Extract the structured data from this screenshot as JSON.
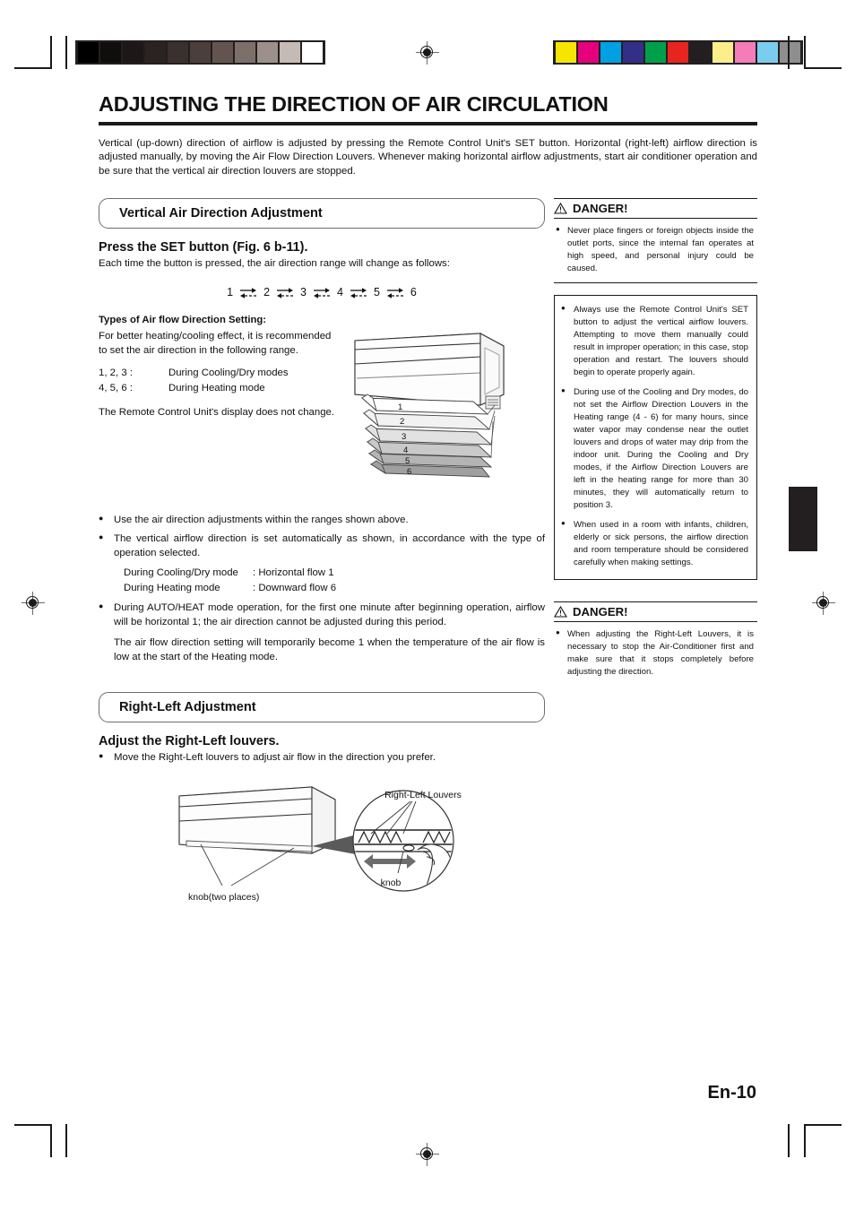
{
  "page": {
    "title": "ADJUSTING THE DIRECTION OF AIR CIRCULATION",
    "number": "En-10",
    "intro": "Vertical (up-down) direction of airflow is adjusted by pressing the Remote Control Unit's SET button. Horizontal (right-left) airflow direction is adjusted manually, by moving the Air Flow Direction Louvers. Whenever making horizontal airflow adjustments, start air conditioner operation and be sure that the vertical air direction louvers are stopped."
  },
  "vertical_section": {
    "banner": "Vertical Air Direction Adjustment",
    "heading": "Press the SET button (Fig. 6 b-11).",
    "lead": "Each time the button is pressed, the air direction range will change as follows:",
    "sequence": [
      "1",
      "2",
      "3",
      "4",
      "5",
      "6"
    ],
    "types_label": "Types of Air flow Direction Setting:",
    "types_lead": "For better heating/cooling effect, it is recommended to set the air direction in the following range.",
    "modes": [
      {
        "key": "1, 2, 3 :",
        "value": "During Cooling/Dry modes"
      },
      {
        "key": "4, 5, 6 :",
        "value": "During Heating mode"
      }
    ],
    "display_note": "The Remote Control Unit's display does not change.",
    "figure_labels": [
      "1",
      "2",
      "3",
      "4",
      "5",
      "6"
    ],
    "bullets": [
      "Use the air direction adjustments within the ranges shown above.",
      "The vertical airflow direction is set automatically as shown, in accordance with the type of operation selected."
    ],
    "auto_modes": [
      {
        "mode": "During Cooling/Dry mode",
        "flow": ": Horizontal flow 1"
      },
      {
        "mode": "During Heating mode",
        "flow": ": Downward flow 6"
      }
    ],
    "bullet_auto_heat": "During AUTO/HEAT mode operation, for the first one minute after beginning operation, airflow will be horizontal 1; the air direction cannot be adjusted during this period.",
    "temp_note": "The air flow direction setting will temporarily become 1 when the temperature of the air flow is low at the start of the Heating mode."
  },
  "rightleft_section": {
    "banner": "Right-Left Adjustment",
    "heading": "Adjust the Right-Left louvers.",
    "bullet": "Move the Right-Left louvers to adjust air flow in the direction you prefer.",
    "figure": {
      "louvers_label": "Right-Left Louvers",
      "knob_label": "knob",
      "knob_two_places_label": "knob(two places)"
    }
  },
  "danger_boxes": [
    {
      "title": "DANGER!",
      "items": [
        "Never place fingers or foreign objects inside the outlet ports, since the internal fan operates at high speed, and personal injury could be caused."
      ]
    },
    {
      "title": "DANGER!",
      "items": [
        "When adjusting the Right-Left Louvers, it is necessary to stop the Air-Conditioner first and make sure that it stops completely before adjusting the direction."
      ]
    }
  ],
  "caution_box": {
    "items": [
      "Always use the Remote Control Unit's SET button to adjust the vertical airflow louvers. Attempting to move them manually could result in improper operation; in this case, stop operation and restart. The louvers should begin to operate properly again.",
      "During use of the Cooling and Dry modes, do not set the Airflow Direction Louvers in the Heating range (4 - 6) for many hours, since water vapor may condense near the outlet louvers and drops of water may drip from the indoor unit. During the Cooling and Dry modes, if the Airflow Direction Louvers are left in the heating range for more than 30 minutes, they will automatically return to position 3.",
      "When used in a room with infants, children, elderly or sick persons, the airflow direction and room temperature should be considered carefully when making settings."
    ]
  },
  "print_marks": {
    "gray_strip": [
      "#000000",
      "#100d0d",
      "#1d1717",
      "#2b2322",
      "#3a302e",
      "#4b3f3c",
      "#63544f",
      "#7d6f6a",
      "#9d908b",
      "#c6bab4",
      "#ffffff"
    ],
    "color_strip": [
      "#f5e500",
      "#e6007e",
      "#00a0e3",
      "#332e87",
      "#00a04a",
      "#e8241f",
      "#231f20",
      "#fbee8b",
      "#f47cb8",
      "#7bcdf0",
      "#8e8e8e"
    ]
  }
}
